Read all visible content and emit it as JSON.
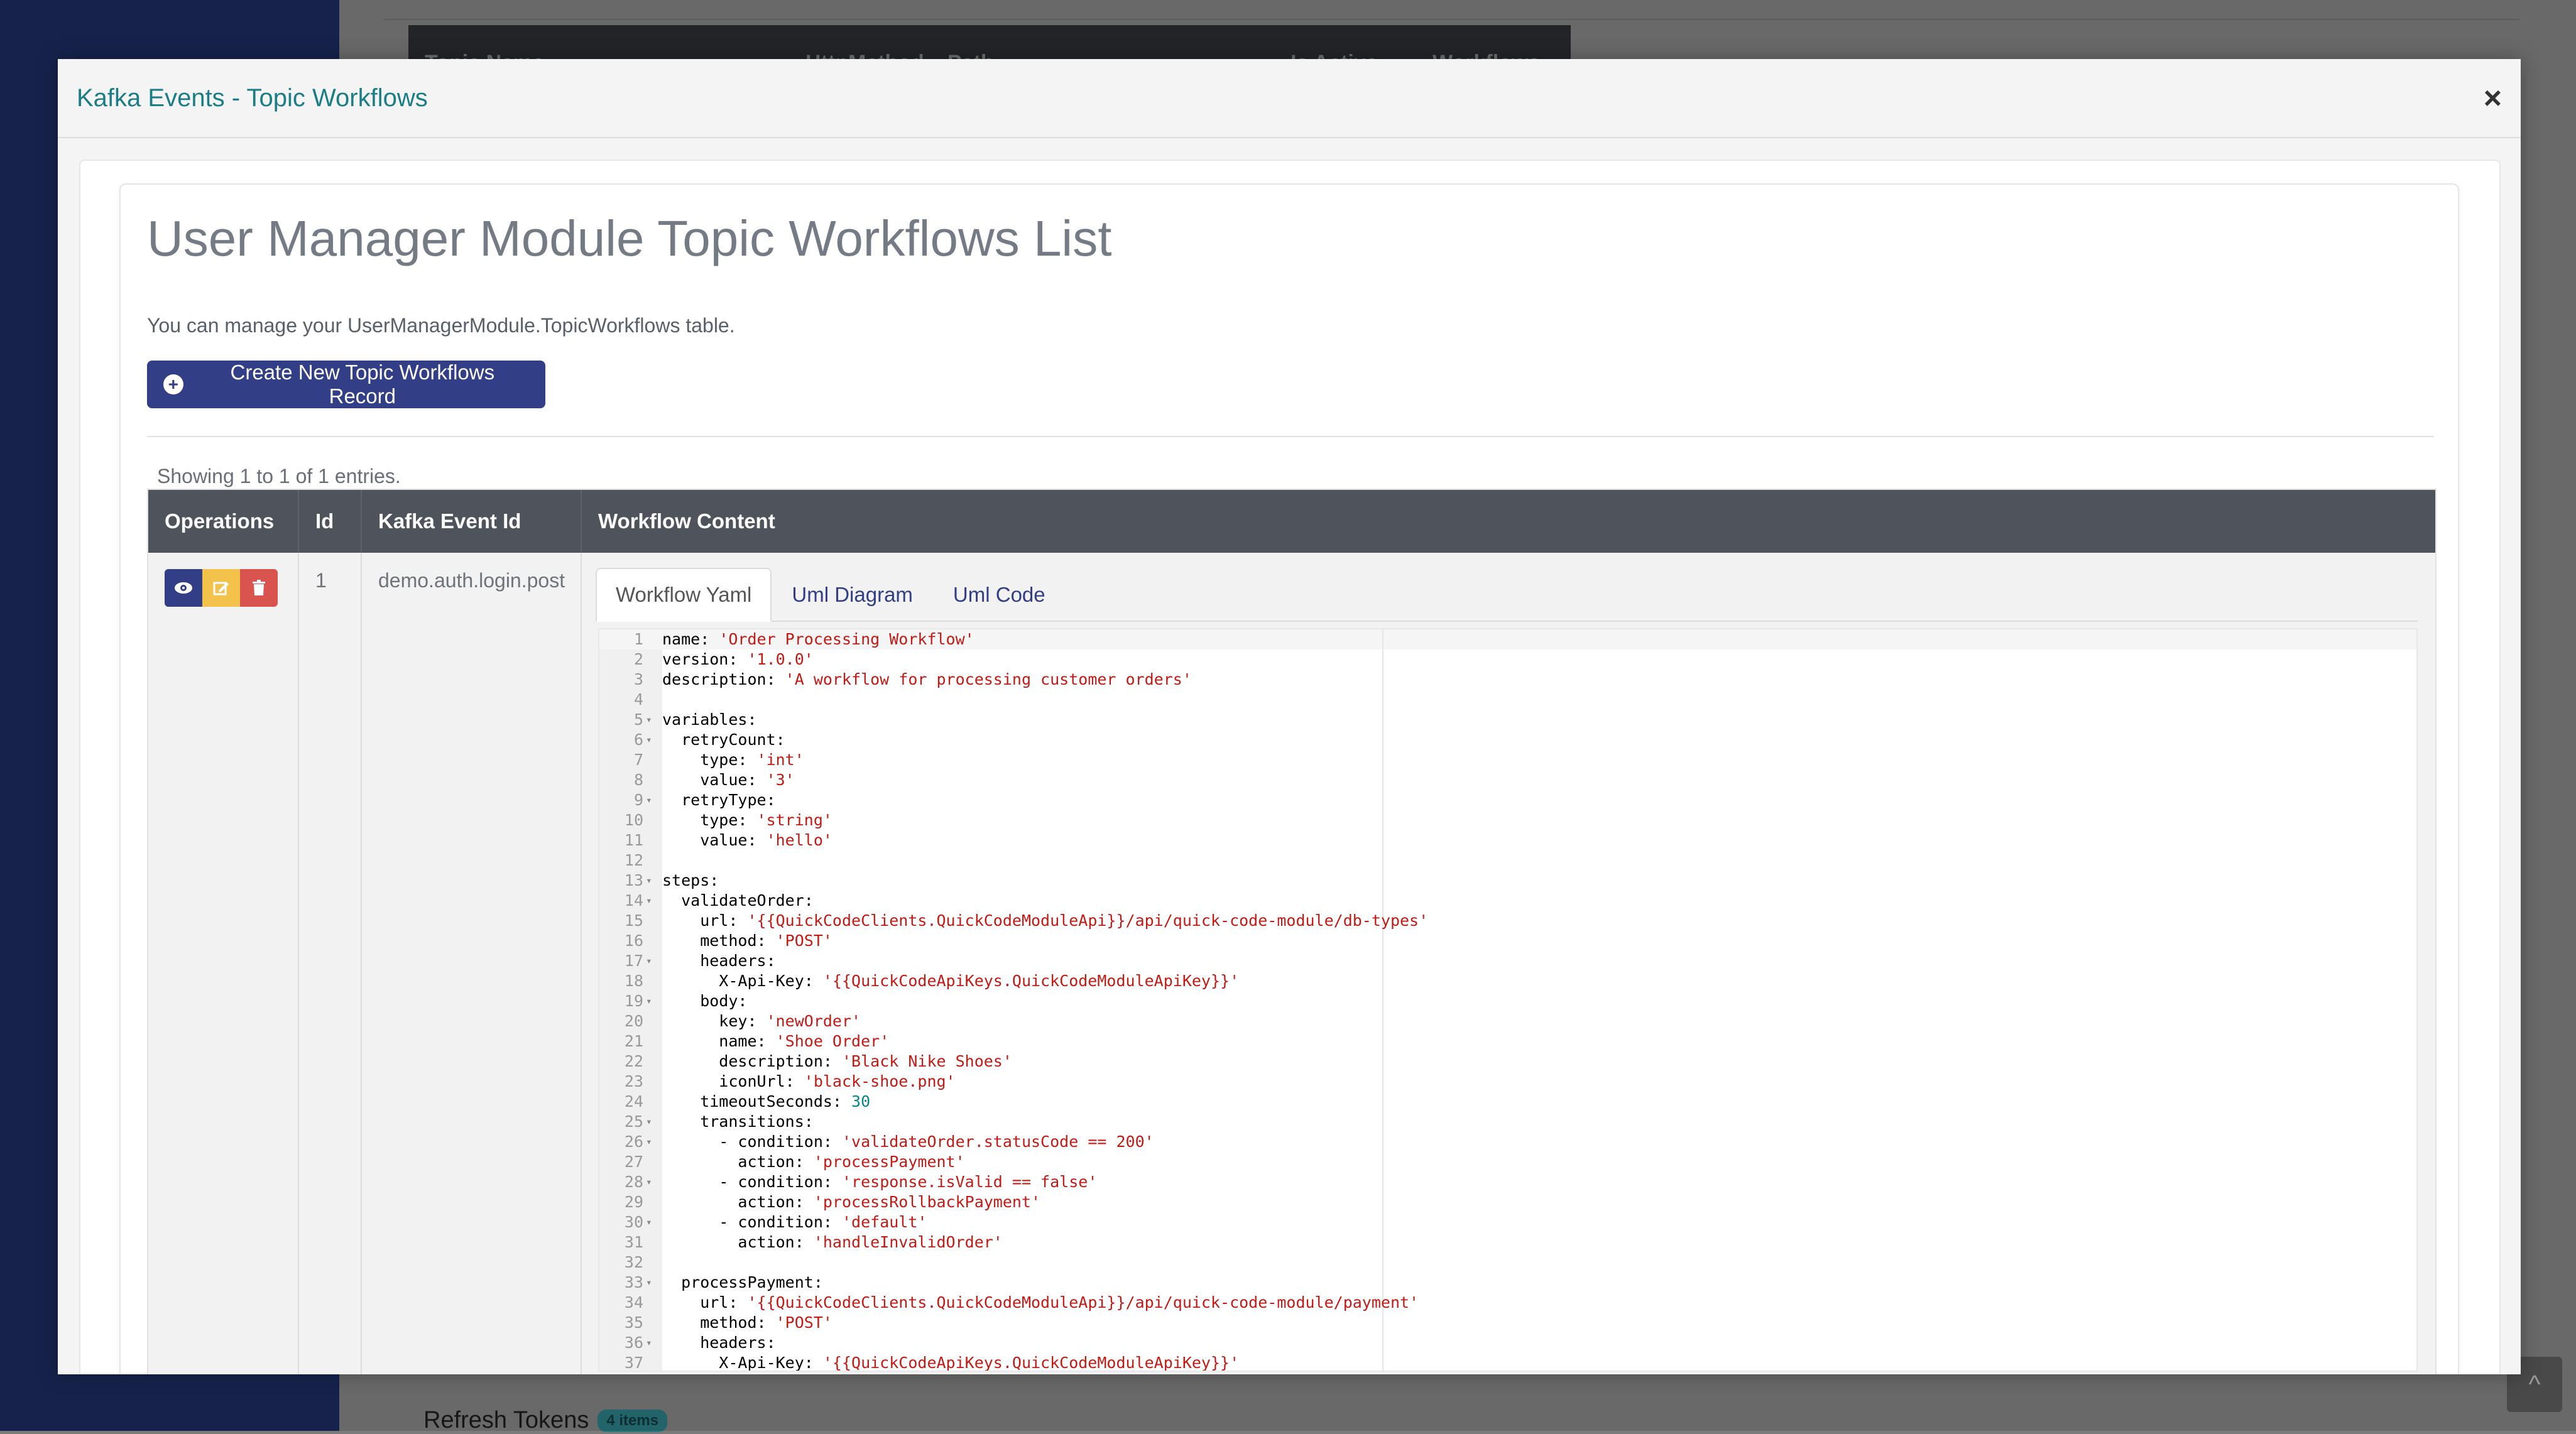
{
  "background": {
    "table_headers": [
      "Topic Name",
      "HttpMethod",
      "Path",
      "Is Active",
      "Workflows"
    ],
    "refresh_tokens_label": "Refresh Tokens",
    "refresh_tokens_badge": "4 items",
    "scroll_top_icon": "chevron-up-icon"
  },
  "modal": {
    "title": "Kafka Events - Topic Workflows",
    "close_icon": "close-icon",
    "close_label": "×"
  },
  "page": {
    "title": "User Manager Module Topic Workflows List",
    "description": "You can manage your UserManagerModule.TopicWorkflows table.",
    "create_button": "Create New Topic Workflows Record",
    "showing": "Showing 1 to 1 of 1 entries."
  },
  "table": {
    "headers": {
      "operations": "Operations",
      "id": "Id",
      "kafka_event_id": "Kafka Event Id",
      "workflow_content": "Workflow Content"
    },
    "rows": [
      {
        "id": "1",
        "kafka_event_id": "demo.auth.login.post"
      }
    ]
  },
  "tabs": [
    {
      "label": "Workflow Yaml",
      "active": true
    },
    {
      "label": "Uml Diagram",
      "active": false
    },
    {
      "label": "Uml Code",
      "active": false
    }
  ],
  "code_lines": [
    {
      "n": "1",
      "f": "",
      "t": [
        [
          "k",
          "name: "
        ],
        [
          "s",
          "'Order Processing Workflow'"
        ]
      ]
    },
    {
      "n": "2",
      "f": "",
      "t": [
        [
          "k",
          "version: "
        ],
        [
          "s",
          "'1.0.0'"
        ]
      ]
    },
    {
      "n": "3",
      "f": "",
      "t": [
        [
          "k",
          "description: "
        ],
        [
          "s",
          "'A workflow for processing customer orders'"
        ]
      ]
    },
    {
      "n": "4",
      "f": "",
      "t": []
    },
    {
      "n": "5",
      "f": "▾",
      "t": [
        [
          "k",
          "variables:"
        ]
      ]
    },
    {
      "n": "6",
      "f": "▾",
      "t": [
        [
          "k",
          "  retryCount:"
        ]
      ]
    },
    {
      "n": "7",
      "f": "",
      "t": [
        [
          "k",
          "    type: "
        ],
        [
          "s",
          "'int'"
        ]
      ]
    },
    {
      "n": "8",
      "f": "",
      "t": [
        [
          "k",
          "    value: "
        ],
        [
          "s",
          "'3'"
        ]
      ]
    },
    {
      "n": "9",
      "f": "▾",
      "t": [
        [
          "k",
          "  retryType:"
        ]
      ]
    },
    {
      "n": "10",
      "f": "",
      "t": [
        [
          "k",
          "    type: "
        ],
        [
          "s",
          "'string'"
        ]
      ]
    },
    {
      "n": "11",
      "f": "",
      "t": [
        [
          "k",
          "    value: "
        ],
        [
          "s",
          "'hello'"
        ]
      ]
    },
    {
      "n": "12",
      "f": "",
      "t": []
    },
    {
      "n": "13",
      "f": "▾",
      "t": [
        [
          "k",
          "steps:"
        ]
      ]
    },
    {
      "n": "14",
      "f": "▾",
      "t": [
        [
          "k",
          "  validateOrder:"
        ]
      ]
    },
    {
      "n": "15",
      "f": "",
      "t": [
        [
          "k",
          "    url: "
        ],
        [
          "s",
          "'{{QuickCodeClients.QuickCodeModuleApi}}/api/quick-code-module/db-types'"
        ]
      ]
    },
    {
      "n": "16",
      "f": "",
      "t": [
        [
          "k",
          "    method: "
        ],
        [
          "s",
          "'POST'"
        ]
      ]
    },
    {
      "n": "17",
      "f": "▾",
      "t": [
        [
          "k",
          "    headers:"
        ]
      ]
    },
    {
      "n": "18",
      "f": "",
      "t": [
        [
          "k",
          "      X-Api-Key: "
        ],
        [
          "s",
          "'{{QuickCodeApiKeys.QuickCodeModuleApiKey}}'"
        ]
      ]
    },
    {
      "n": "19",
      "f": "▾",
      "t": [
        [
          "k",
          "    body:"
        ]
      ]
    },
    {
      "n": "20",
      "f": "",
      "t": [
        [
          "k",
          "      key: "
        ],
        [
          "s",
          "'newOrder'"
        ]
      ]
    },
    {
      "n": "21",
      "f": "",
      "t": [
        [
          "k",
          "      name: "
        ],
        [
          "s",
          "'Shoe Order'"
        ]
      ]
    },
    {
      "n": "22",
      "f": "",
      "t": [
        [
          "k",
          "      description: "
        ],
        [
          "s",
          "'Black Nike Shoes'"
        ]
      ]
    },
    {
      "n": "23",
      "f": "",
      "t": [
        [
          "k",
          "      iconUrl: "
        ],
        [
          "s",
          "'black-shoe.png'"
        ]
      ]
    },
    {
      "n": "24",
      "f": "",
      "t": [
        [
          "k",
          "    timeoutSeconds: "
        ],
        [
          "n",
          "30"
        ]
      ]
    },
    {
      "n": "25",
      "f": "▾",
      "t": [
        [
          "k",
          "    transitions:"
        ]
      ]
    },
    {
      "n": "26",
      "f": "▾",
      "t": [
        [
          "k",
          "      - condition: "
        ],
        [
          "s",
          "'validateOrder.statusCode == 200'"
        ]
      ]
    },
    {
      "n": "27",
      "f": "",
      "t": [
        [
          "k",
          "        action: "
        ],
        [
          "s",
          "'processPayment'"
        ]
      ]
    },
    {
      "n": "28",
      "f": "▾",
      "t": [
        [
          "k",
          "      - condition: "
        ],
        [
          "s",
          "'response.isValid == false'"
        ]
      ]
    },
    {
      "n": "29",
      "f": "",
      "t": [
        [
          "k",
          "        action: "
        ],
        [
          "s",
          "'processRollbackPayment'"
        ]
      ]
    },
    {
      "n": "30",
      "f": "▾",
      "t": [
        [
          "k",
          "      - condition: "
        ],
        [
          "s",
          "'default'"
        ]
      ]
    },
    {
      "n": "31",
      "f": "",
      "t": [
        [
          "k",
          "        action: "
        ],
        [
          "s",
          "'handleInvalidOrder'"
        ]
      ]
    },
    {
      "n": "32",
      "f": "",
      "t": []
    },
    {
      "n": "33",
      "f": "▾",
      "t": [
        [
          "k",
          "  processPayment:"
        ]
      ]
    },
    {
      "n": "34",
      "f": "",
      "t": [
        [
          "k",
          "    url: "
        ],
        [
          "s",
          "'{{QuickCodeClients.QuickCodeModuleApi}}/api/quick-code-module/payment'"
        ]
      ]
    },
    {
      "n": "35",
      "f": "",
      "t": [
        [
          "k",
          "    method: "
        ],
        [
          "s",
          "'POST'"
        ]
      ]
    },
    {
      "n": "36",
      "f": "▾",
      "t": [
        [
          "k",
          "    headers:"
        ]
      ]
    },
    {
      "n": "37",
      "f": "",
      "t": [
        [
          "k",
          "      X-Api-Key: "
        ],
        [
          "s",
          "'{{QuickCodeApiKeys.QuickCodeModuleApiKey}}'"
        ]
      ]
    }
  ]
}
